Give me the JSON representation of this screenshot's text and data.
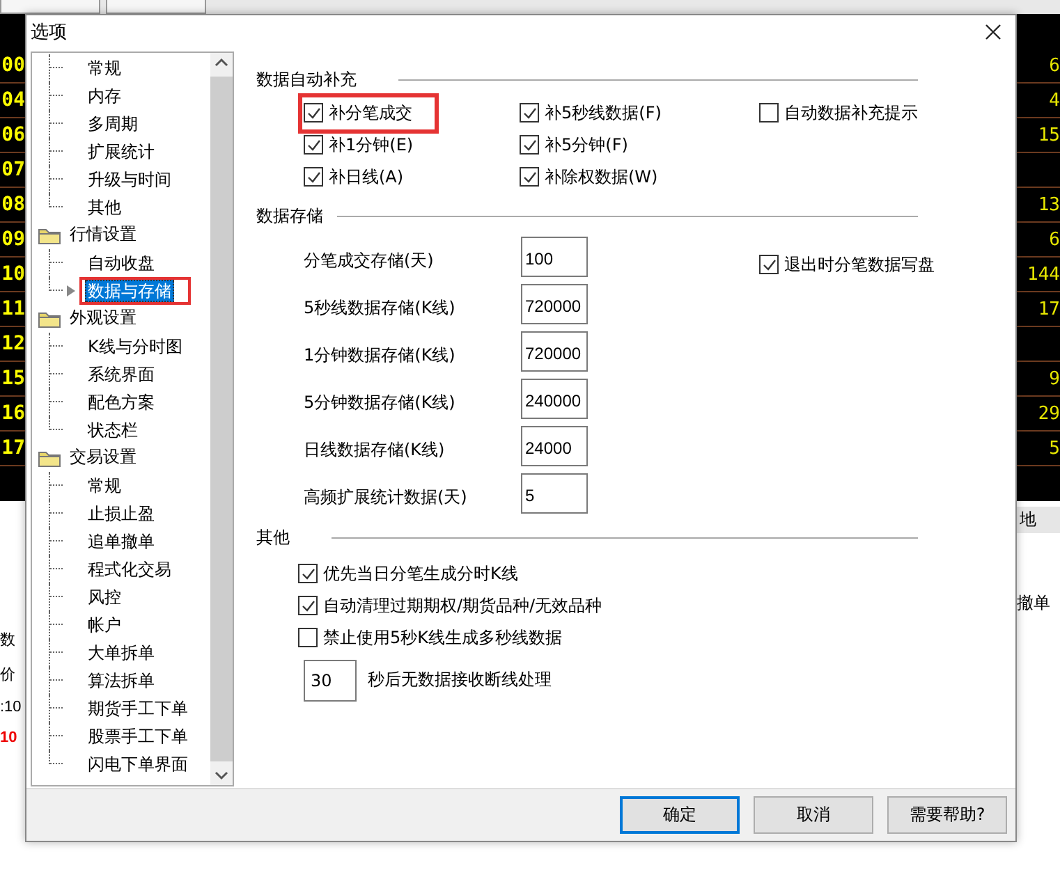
{
  "background": {
    "left_cells": [
      "00",
      "04",
      "06",
      "07",
      "08",
      "09",
      "10",
      "11",
      "12",
      "15",
      "16",
      "17"
    ],
    "right_cells": [
      "6",
      "4",
      "15",
      "",
      "13",
      "6",
      "144",
      "17",
      "",
      "9",
      "29",
      "5"
    ],
    "right_tab": "地",
    "right_label": "撤单",
    "left_labels": [
      "数",
      "价",
      ":10"
    ],
    "left_price": "10"
  },
  "dialog": {
    "title": "选项",
    "tree": [
      {
        "children": [
          {
            "label": "常规",
            "selected": false,
            "highlighted": false
          },
          {
            "label": "内存",
            "selected": false,
            "highlighted": false
          },
          {
            "label": "多周期",
            "selected": false,
            "highlighted": false
          },
          {
            "label": "扩展统计",
            "selected": false,
            "highlighted": false
          },
          {
            "label": "升级与时间",
            "selected": false,
            "highlighted": false
          },
          {
            "label": "其他",
            "selected": false,
            "highlighted": false
          }
        ]
      },
      {
        "label": "行情设置",
        "children": [
          {
            "label": "自动收盘",
            "selected": false,
            "highlighted": false
          },
          {
            "label": "数据与存储",
            "selected": true,
            "highlighted": true
          }
        ]
      },
      {
        "label": "外观设置",
        "children": [
          {
            "label": "K线与分时图",
            "selected": false,
            "highlighted": false
          },
          {
            "label": "系统界面",
            "selected": false,
            "highlighted": false
          },
          {
            "label": "配色方案",
            "selected": false,
            "highlighted": false
          },
          {
            "label": "状态栏",
            "selected": false,
            "highlighted": false
          }
        ]
      },
      {
        "label": "交易设置",
        "children": [
          {
            "label": "常规",
            "selected": false,
            "highlighted": false
          },
          {
            "label": "止损止盈",
            "selected": false,
            "highlighted": false
          },
          {
            "label": "追单撤单",
            "selected": false,
            "highlighted": false
          },
          {
            "label": "程式化交易",
            "selected": false,
            "highlighted": false
          },
          {
            "label": "风控",
            "selected": false,
            "highlighted": false
          },
          {
            "label": "帐户",
            "selected": false,
            "highlighted": false
          },
          {
            "label": "大单拆单",
            "selected": false,
            "highlighted": false
          },
          {
            "label": "算法拆单",
            "selected": false,
            "highlighted": false
          },
          {
            "label": "期货手工下单",
            "selected": false,
            "highlighted": false
          },
          {
            "label": "股票手工下单",
            "selected": false,
            "highlighted": false
          },
          {
            "label": "闪电下单界面",
            "selected": false,
            "highlighted": false
          }
        ]
      }
    ],
    "auto_fill": {
      "title": "数据自动补充",
      "rows": [
        [
          {
            "label": "补分笔成交",
            "checked": true,
            "highlighted": true
          },
          {
            "label": "补5秒线数据(F)",
            "checked": true,
            "highlighted": false
          },
          {
            "label": "自动数据补充提示",
            "checked": false,
            "highlighted": false
          }
        ],
        [
          {
            "label": "补1分钟(E)",
            "checked": true,
            "highlighted": false
          },
          {
            "label": "补5分钟(F)",
            "checked": true,
            "highlighted": false
          }
        ],
        [
          {
            "label": "补日线(A)",
            "checked": true,
            "highlighted": false
          },
          {
            "label": "补除权数据(W)",
            "checked": true,
            "highlighted": false
          }
        ]
      ]
    },
    "storage": {
      "title": "数据存储",
      "fields": [
        {
          "label": "分笔成交存储(天)",
          "value": "100"
        },
        {
          "label": "5秒线数据存储(K线)",
          "value": "720000"
        },
        {
          "label": "1分钟数据存储(K线)",
          "value": "720000"
        },
        {
          "label": "5分钟数据存储(K线)",
          "value": "240000"
        },
        {
          "label": "日线数据存储(K线)",
          "value": "24000"
        },
        {
          "label": "高频扩展统计数据(天)",
          "value": "5"
        }
      ],
      "side_option": {
        "label": "退出时分笔数据写盘",
        "checked": true
      }
    },
    "other": {
      "title": "其他",
      "options": [
        {
          "label": "优先当日分笔生成分时K线",
          "checked": true
        },
        {
          "label": "自动清理过期期权/期货品种/无效品种",
          "checked": true
        },
        {
          "label": "禁止使用5秒K线生成多秒线数据",
          "checked": false
        }
      ],
      "timeout": {
        "value": "30",
        "label": "秒后无数据接收断线处理"
      }
    },
    "buttons": [
      {
        "label": "确定",
        "default": true
      },
      {
        "label": "取消",
        "default": false
      },
      {
        "label": "需要帮助?",
        "default": false
      }
    ]
  }
}
